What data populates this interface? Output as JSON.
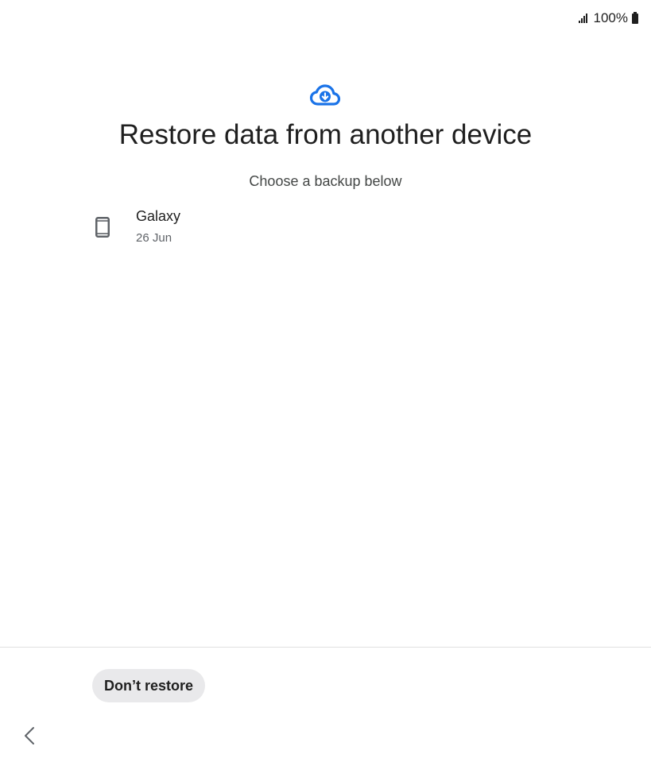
{
  "status_bar": {
    "signal_icon": "signal-icon",
    "battery_text": "100%",
    "battery_icon": "battery-icon"
  },
  "header": {
    "icon": "cloud-download-icon",
    "icon_color": "#1a73e8",
    "title": "Restore data from another device",
    "subtitle": "Choose a backup below"
  },
  "backups": [
    {
      "icon": "phone-icon",
      "name": "Galaxy",
      "date": "26 Jun"
    }
  ],
  "footer": {
    "dont_restore_label": "Don’t restore",
    "back_icon": "chevron-left-icon"
  }
}
